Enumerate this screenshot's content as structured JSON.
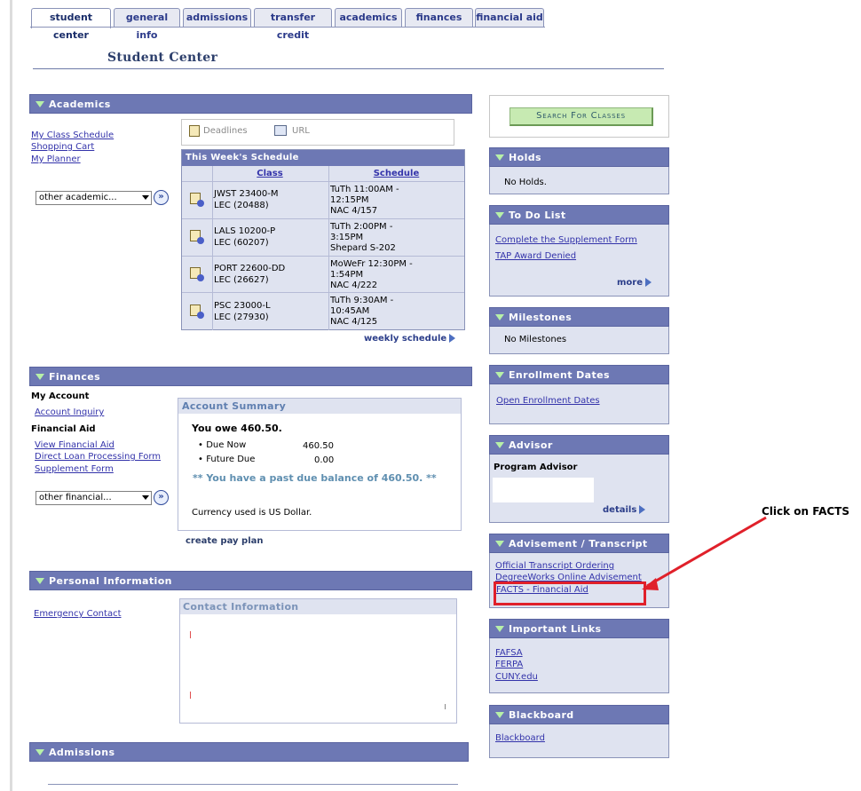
{
  "tabs": [
    {
      "label": "student center",
      "active": true
    },
    {
      "label": "general info"
    },
    {
      "label": "admissions"
    },
    {
      "label": "transfer credit"
    },
    {
      "label": "academics"
    },
    {
      "label": "finances"
    },
    {
      "label": "financial aid"
    }
  ],
  "page_title": "Student Center",
  "academics": {
    "header": "Academics",
    "links": [
      "My Class Schedule",
      "Shopping Cart",
      "My Planner"
    ],
    "select_value": "other academic...",
    "deadlines_label": "Deadlines",
    "url_label": "URL",
    "schedule_title": "This Week's Schedule",
    "col_class": "Class",
    "col_schedule": "Schedule",
    "rows": [
      {
        "class1": "JWST 23400-M",
        "class2": "LEC (20488)",
        "s1": "TuTh 11:00AM -",
        "s2": "12:15PM",
        "s3": "NAC 4/157"
      },
      {
        "class1": "LALS 10200-P",
        "class2": "LEC (60207)",
        "s1": "TuTh 2:00PM -",
        "s2": "3:15PM",
        "s3": "Shepard S-202"
      },
      {
        "class1": "PORT 22600-DD",
        "class2": "LEC (26627)",
        "s1": "MoWeFr 12:30PM -",
        "s2": "1:54PM",
        "s3": "NAC 4/222"
      },
      {
        "class1": "PSC 23000-L",
        "class2": "LEC (27930)",
        "s1": "TuTh 9:30AM -",
        "s2": "10:45AM",
        "s3": "NAC 4/125"
      }
    ],
    "weekly_schedule": "weekly schedule"
  },
  "finances": {
    "header": "Finances",
    "my_account": "My Account",
    "account_inquiry": "Account Inquiry",
    "financial_aid": "Financial Aid",
    "fa_links": [
      "View Financial Aid",
      "Direct Loan Processing Form",
      "Supplement Form"
    ],
    "select_value": "other financial...",
    "summary_title": "Account Summary",
    "you_owe": "You owe 460.50.",
    "due_now_label": "Due Now",
    "due_now_value": "460.50",
    "future_due_label": "Future Due",
    "future_due_value": "0.00",
    "past_due_msg": "** You have a past due balance of 460.50. **",
    "currency_note": "Currency used is US Dollar.",
    "create_pay_plan": "create pay plan"
  },
  "personal": {
    "header": "Personal Information",
    "emergency_contact": "Emergency Contact",
    "contact_title": "Contact Information"
  },
  "admissions": {
    "header": "Admissions"
  },
  "right": {
    "search_button": "Search For Classes",
    "holds": {
      "header": "Holds",
      "text": "No Holds."
    },
    "todo": {
      "header": "To Do List",
      "links": [
        "Complete the Supplement Form",
        "TAP Award Denied"
      ],
      "more": "more"
    },
    "milestones": {
      "header": "Milestones",
      "text": "No Milestones"
    },
    "enrollment": {
      "header": "Enrollment Dates",
      "link": "Open Enrollment Dates"
    },
    "advisor": {
      "header": "Advisor",
      "program_advisor": "Program Advisor",
      "details": "details"
    },
    "advisement": {
      "header": "Advisement / Transcript",
      "links": [
        "Official Transcript Ordering",
        "DegreeWorks Online Advisement",
        "FACTS - Financial Aid"
      ]
    },
    "important": {
      "header": "Important Links",
      "links": [
        "FAFSA",
        "FERPA",
        "CUNY.edu"
      ]
    },
    "blackboard": {
      "header": "Blackboard",
      "link": "Blackboard"
    }
  },
  "annotation": {
    "text": "Click on FACTS",
    "color": "#e0202a"
  }
}
